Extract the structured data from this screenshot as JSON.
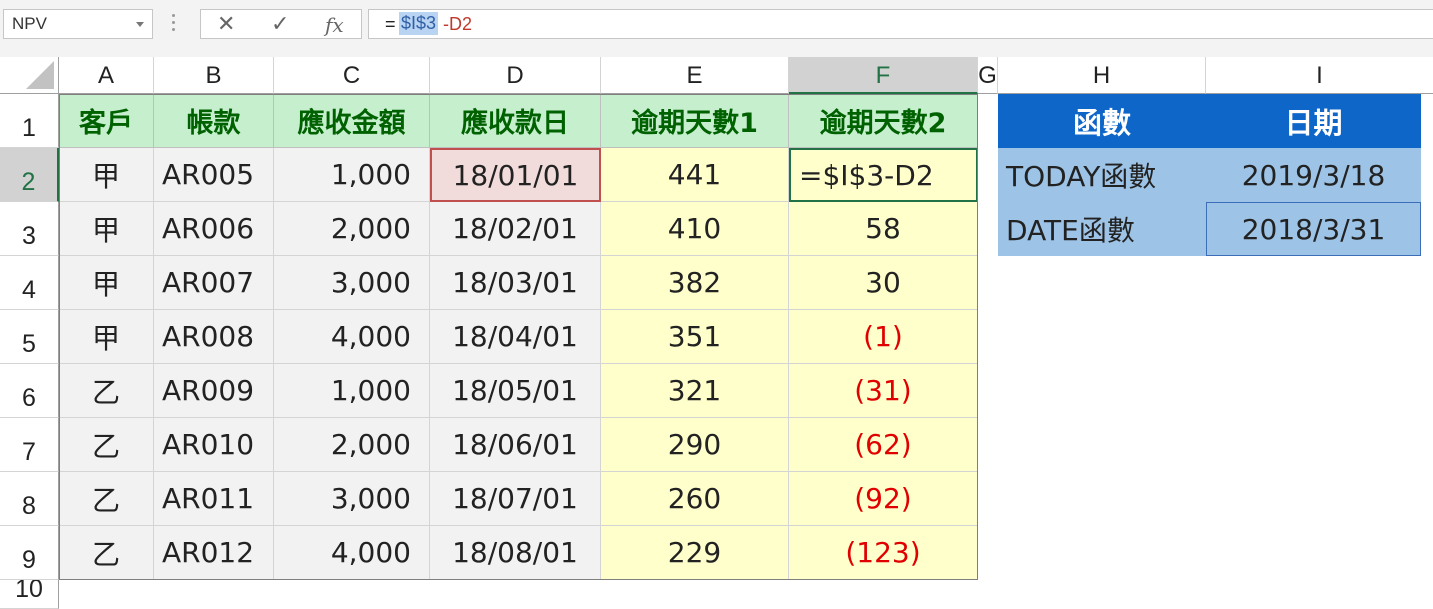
{
  "formula_bar": {
    "name_box": "NPV",
    "cancel_glyph": "✕",
    "enter_glyph": "✓",
    "fx_glyph": "fx",
    "formula_eq": "=",
    "formula_ref": "$I$3",
    "formula_rest": "-D2"
  },
  "columns": [
    "A",
    "B",
    "C",
    "D",
    "E",
    "F",
    "G",
    "H",
    "I"
  ],
  "rows": [
    "1",
    "2",
    "3",
    "4",
    "5",
    "6",
    "7",
    "8",
    "9",
    "10"
  ],
  "table": {
    "headers": [
      "客戶",
      "帳款",
      "應收金額",
      "應收款日",
      "逾期天數1",
      "逾期天數2"
    ],
    "rows": [
      [
        "甲",
        "AR005",
        "1,000",
        "18/01/01",
        "441",
        "=$I$3-D2"
      ],
      [
        "甲",
        "AR006",
        "2,000",
        "18/02/01",
        "410",
        "58"
      ],
      [
        "甲",
        "AR007",
        "3,000",
        "18/03/01",
        "382",
        "30"
      ],
      [
        "甲",
        "AR008",
        "4,000",
        "18/04/01",
        "351",
        "(1)"
      ],
      [
        "乙",
        "AR009",
        "1,000",
        "18/05/01",
        "321",
        "(31)"
      ],
      [
        "乙",
        "AR010",
        "2,000",
        "18/06/01",
        "290",
        "(62)"
      ],
      [
        "乙",
        "AR011",
        "3,000",
        "18/07/01",
        "260",
        "(92)"
      ],
      [
        "乙",
        "AR012",
        "4,000",
        "18/08/01",
        "229",
        "(123)"
      ]
    ]
  },
  "side_table": {
    "headers": [
      "函數",
      "日期"
    ],
    "rows": [
      [
        "TODAY函數",
        "2019/3/18"
      ],
      [
        "DATE函數",
        "2018/3/31"
      ]
    ]
  },
  "colors": {
    "header_green_bg": "#c6efce",
    "header_green_text": "#006100",
    "negative_red": "#e00000",
    "side_header_blue": "#0e66c8",
    "side_cell_blue": "#9dc3e6",
    "due_date_highlight": "#f2dcdb",
    "yellow_fill": "#ffffcc"
  }
}
